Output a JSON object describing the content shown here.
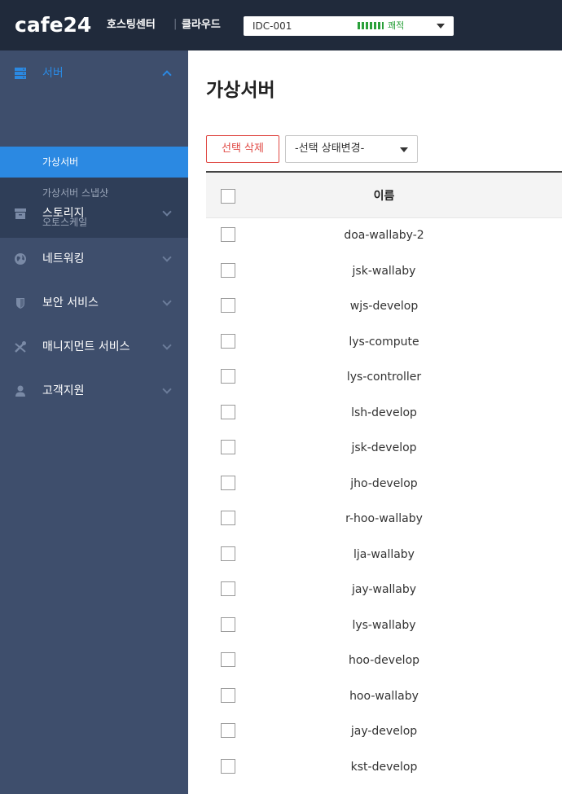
{
  "header": {
    "logo": "cafe24",
    "logo_sub": "호스팅센터",
    "separator": "|",
    "logo_sub2": "클라우드",
    "idc": {
      "name": "IDC-001",
      "status": "쾌적",
      "status_color": "#2aa03a"
    }
  },
  "sidebar": {
    "groups": [
      {
        "label": "서버",
        "icon": "server-icon",
        "expanded": true
      },
      {
        "label": "스토리지",
        "icon": "storage-icon",
        "expanded": false
      },
      {
        "label": "네트워킹",
        "icon": "globe-icon",
        "expanded": false
      },
      {
        "label": "보안 서비스",
        "icon": "shield-icon",
        "expanded": false
      },
      {
        "label": "매니지먼트 서비스",
        "icon": "tools-icon",
        "expanded": false
      },
      {
        "label": "고객지원",
        "icon": "person-icon",
        "expanded": false
      }
    ],
    "server_items": [
      {
        "label": "가상서버",
        "active": true
      },
      {
        "label": "가상서버 스냅샷",
        "active": false
      },
      {
        "label": "오토스케일",
        "active": false
      }
    ]
  },
  "main": {
    "title": "가상서버",
    "delete_label": "선택 삭제",
    "status_select": "-선택 상태변경-",
    "table": {
      "header_name": "이름",
      "rows": [
        "doa-wallaby-2",
        "jsk-wallaby",
        "wjs-develop",
        "lys-compute",
        "lys-controller",
        "lsh-develop",
        "jsk-develop",
        "jho-develop",
        "r-hoo-wallaby",
        "lja-wallaby",
        "jay-wallaby",
        "lys-wallaby",
        "hoo-develop",
        "hoo-wallaby",
        "jay-develop",
        "kst-develop"
      ]
    }
  },
  "colors": {
    "topbar": "#202a3b",
    "sidebar": "#3e4e6c",
    "submenu": "#2f3e58",
    "accent": "#2b89e2",
    "danger": "#e04a45"
  }
}
